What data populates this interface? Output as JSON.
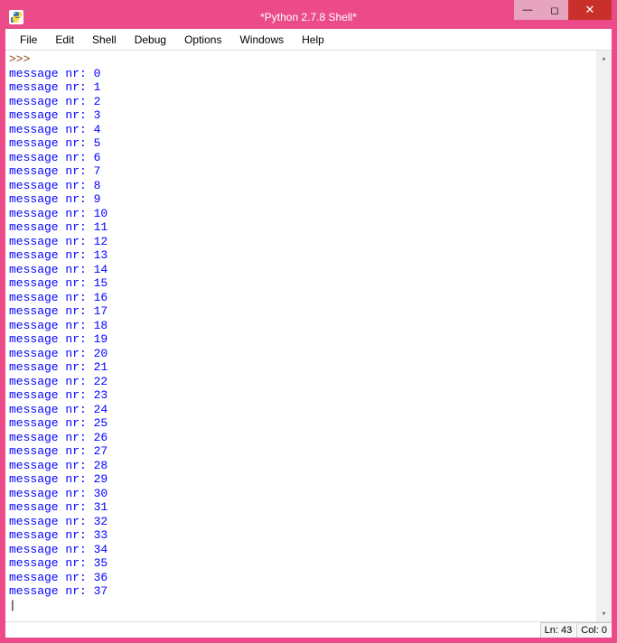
{
  "window": {
    "title": "*Python 2.7.8 Shell*"
  },
  "menubar": {
    "items": [
      "File",
      "Edit",
      "Shell",
      "Debug",
      "Options",
      "Windows",
      "Help"
    ]
  },
  "shell": {
    "prompt": ">>> ",
    "output_lines": [
      "message nr: 0",
      "message nr: 1",
      "message nr: 2",
      "message nr: 3",
      "message nr: 4",
      "message nr: 5",
      "message nr: 6",
      "message nr: 7",
      "message nr: 8",
      "message nr: 9",
      "message nr: 10",
      "message nr: 11",
      "message nr: 12",
      "message nr: 13",
      "message nr: 14",
      "message nr: 15",
      "message nr: 16",
      "message nr: 17",
      "message nr: 18",
      "message nr: 19",
      "message nr: 20",
      "message nr: 21",
      "message nr: 22",
      "message nr: 23",
      "message nr: 24",
      "message nr: 25",
      "message nr: 26",
      "message nr: 27",
      "message nr: 28",
      "message nr: 29",
      "message nr: 30",
      "message nr: 31",
      "message nr: 32",
      "message nr: 33",
      "message nr: 34",
      "message nr: 35",
      "message nr: 36",
      "message nr: 37"
    ],
    "cursor_line": "|"
  },
  "statusbar": {
    "line_label": "Ln: 43",
    "col_label": "Col: 0"
  },
  "controls": {
    "minimize": "—",
    "maximize": "◻",
    "close": "✕"
  },
  "scroll": {
    "up": "▴",
    "down": "▾"
  }
}
